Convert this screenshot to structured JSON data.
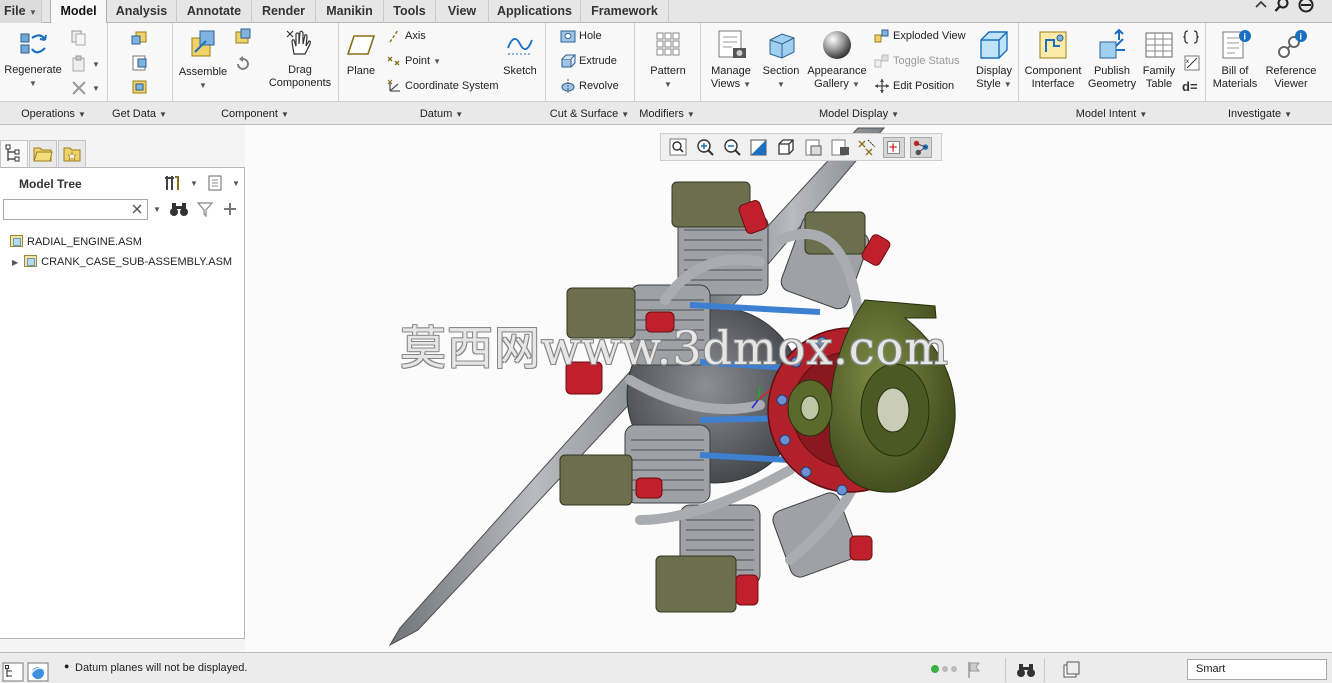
{
  "tabs": {
    "file": "File",
    "items": [
      "Model",
      "Analysis",
      "Annotate",
      "Render",
      "Manikin",
      "Tools",
      "View",
      "Applications",
      "Framework"
    ],
    "active": "Model"
  },
  "ribbon": {
    "operations": {
      "regenerate": "Regenerate",
      "group": "Operations"
    },
    "get_data": {
      "group": "Get Data"
    },
    "component": {
      "assemble": "Assemble",
      "drag_line1": "Drag",
      "drag_line2": "Components",
      "group": "Component"
    },
    "datum": {
      "plane": "Plane",
      "axis": "Axis",
      "point": "Point",
      "coord": "Coordinate System",
      "sketch": "Sketch",
      "group": "Datum"
    },
    "cut_surface": {
      "hole": "Hole",
      "extrude": "Extrude",
      "revolve": "Revolve",
      "group": "Cut & Surface"
    },
    "modifiers": {
      "pattern": "Pattern",
      "group": "Modifiers"
    },
    "model_display": {
      "manage_views_1": "Manage",
      "manage_views_2": "Views",
      "section": "Section",
      "appearance_1": "Appearance",
      "appearance_2": "Gallery",
      "exploded": "Exploded View",
      "toggle": "Toggle Status",
      "edit_pos": "Edit Position",
      "display_1": "Display",
      "display_2": "Style",
      "group": "Model Display"
    },
    "model_intent": {
      "comp_if_1": "Component",
      "comp_if_2": "Interface",
      "publish_1": "Publish",
      "publish_2": "Geometry",
      "family_1": "Family",
      "family_2": "Table",
      "d_eq": "d=",
      "group": "Model Intent"
    },
    "investigate": {
      "bom_1": "Bill of",
      "bom_2": "Materials",
      "ref_1": "Reference",
      "ref_2": "Viewer",
      "group": "Investigate"
    }
  },
  "model_tree": {
    "title": "Model Tree",
    "search_value": "",
    "items": [
      {
        "label": "RADIAL_ENGINE.ASM"
      },
      {
        "label": "CRANK_CASE_SUB-ASSEMBLY.ASM"
      }
    ]
  },
  "graphics": {
    "watermark": "莫西网www.3dmox.com"
  },
  "status": {
    "message": "Datum planes will not be displayed.",
    "filter": "Smart"
  },
  "colors": {
    "accent_blue": "#1a6fbf",
    "flange_red": "#b2202a",
    "olive": "#5b6b2e"
  }
}
